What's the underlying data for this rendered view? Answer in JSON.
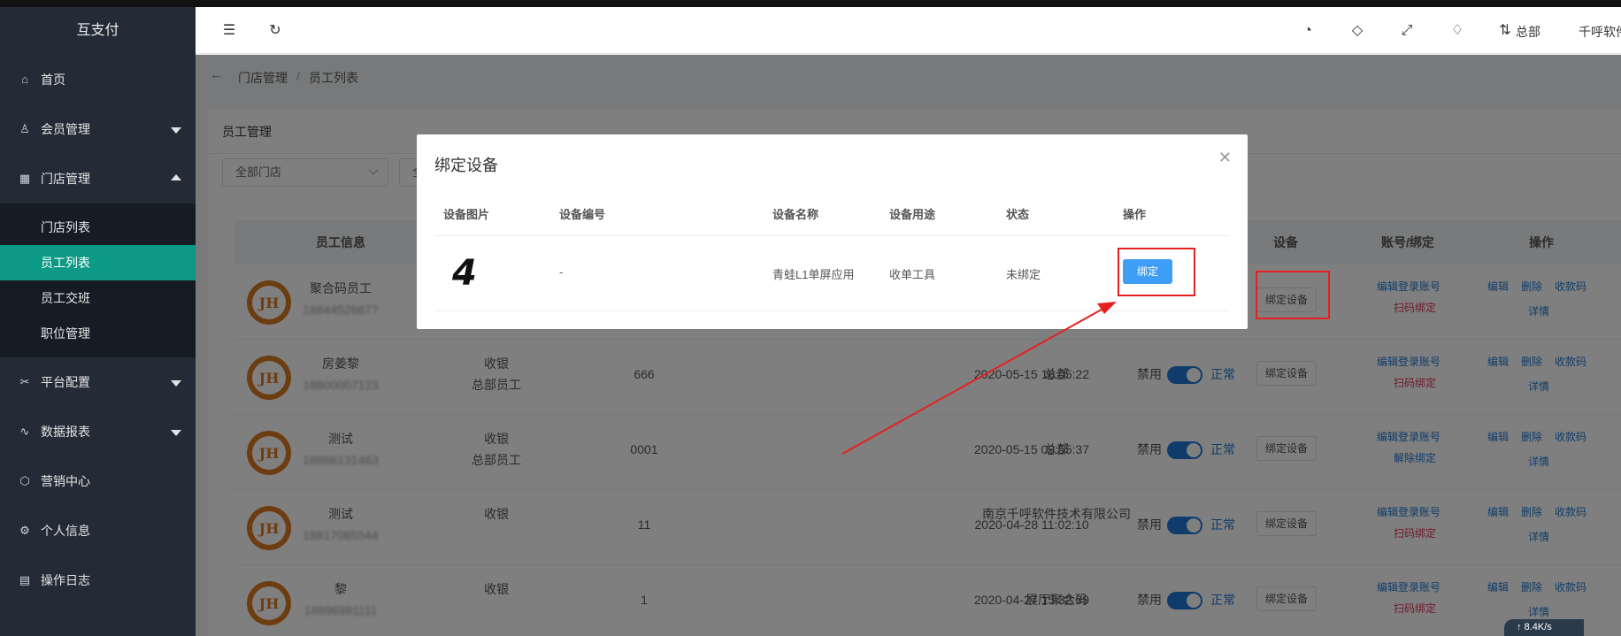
{
  "app": {
    "title": "互支付"
  },
  "sidebar": {
    "items": [
      {
        "label": "首页",
        "icon": "home-icon"
      },
      {
        "label": "会员管理",
        "icon": "user-icon"
      },
      {
        "label": "门店管理",
        "icon": "store-icon"
      },
      {
        "label": "平台配置",
        "icon": "tools-icon"
      },
      {
        "label": "数据报表",
        "icon": "chart-line-icon"
      },
      {
        "label": "营销中心",
        "icon": "cube-icon"
      },
      {
        "label": "个人信息",
        "icon": "gear-icon"
      },
      {
        "label": "操作日志",
        "icon": "document-icon"
      }
    ],
    "submenu": [
      "门店列表",
      "员工列表",
      "员工交班",
      "职位管理"
    ]
  },
  "header": {
    "org": "总部",
    "user": "千呼软件"
  },
  "breadcrumb": {
    "parent": "门店管理",
    "separator": "/",
    "current": "员工列表"
  },
  "card": {
    "title": "员工管理",
    "filters": [
      {
        "value": "全部门店"
      },
      {
        "value": "全"
      }
    ]
  },
  "table": {
    "headers": {
      "info": "员工信息",
      "device": "设备",
      "account": "账号/绑定",
      "ops": "操作"
    },
    "rows": [
      {
        "name": "聚合码员工",
        "phone": "18844526677",
        "role": "",
        "dept": "",
        "code": "",
        "store": "",
        "time": "",
        "status_label": "",
        "status": "",
        "device_btn": "绑定设备",
        "acc_link": "编辑登录账号",
        "bind_link": "扫码绑定",
        "op1": "编辑",
        "op2": "删除",
        "op3": "收款码",
        "op4": "详情"
      },
      {
        "name": "房姜黎",
        "phone": "18800007123",
        "role": "收银",
        "dept": "总部员工",
        "code": "666",
        "store": "总部",
        "time": "2020-05-15 16:05:22",
        "status_label": "禁用",
        "status": "正常",
        "device_btn": "绑定设备",
        "acc_link": "编辑登录账号",
        "bind_link": "扫码绑定",
        "op1": "编辑",
        "op2": "删除",
        "op3": "收款码",
        "op4": "详情"
      },
      {
        "name": "测试",
        "phone": "18866131463",
        "role": "收银",
        "dept": "总部员工",
        "code": "0001",
        "store": "总部",
        "time": "2020-05-15 09:55:37",
        "status_label": "禁用",
        "status": "正常",
        "device_btn": "绑定设备",
        "acc_link": "编辑登录账号",
        "bind_link": "解除绑定",
        "op1": "编辑",
        "op2": "删除",
        "op3": "收款码",
        "op4": "详情"
      },
      {
        "name": "测试",
        "phone": "18817065544",
        "role": "收银",
        "dept": "",
        "code": "11",
        "store": "南京千呼软件技术有限公司",
        "time": "2020-04-28 11:02:10",
        "status_label": "禁用",
        "status": "正常",
        "device_btn": "绑定设备",
        "acc_link": "编辑登录账号",
        "bind_link": "扫码绑定",
        "op1": "编辑",
        "op2": "删除",
        "op3": "收款码",
        "op4": "详情"
      },
      {
        "name": "黎",
        "phone": "18896981111",
        "role": "收银",
        "dept": "",
        "code": "1",
        "store": "展厅聚合码",
        "time": "2020-04-27 15:32:39",
        "status_label": "禁用",
        "status": "正常",
        "device_btn": "绑定设备",
        "acc_link": "编辑登录账号",
        "bind_link": "扫码绑定",
        "op1": "编辑",
        "op2": "删除",
        "op3": "收款码",
        "op4": "详情"
      }
    ]
  },
  "modal": {
    "title": "绑定设备",
    "headers": [
      "设备图片",
      "设备编号",
      "设备名称",
      "设备用途",
      "状态",
      "操作"
    ],
    "row": {
      "image_glyph": "4",
      "code": "-",
      "name": "青蛙L1单屏应用",
      "use": "收单工具",
      "status": "未绑定",
      "action": "绑定"
    }
  },
  "status_bar": {
    "speed": "8.4K/s"
  },
  "colors": {
    "accent": "#0c9a86",
    "link": "#1e78d4",
    "danger": "#e0335a",
    "annotation": "#e52020",
    "primary_button": "#3e9ef5"
  }
}
